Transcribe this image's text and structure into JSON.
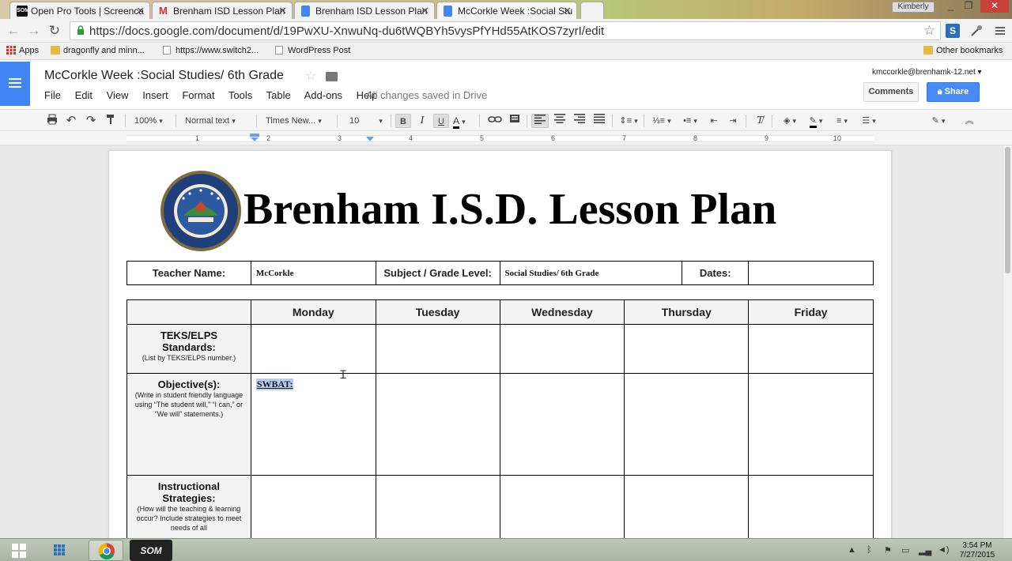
{
  "browser": {
    "tabs": [
      {
        "title": "Open Pro Tools | Screenca",
        "icon": "som-icon",
        "color": "#111111"
      },
      {
        "title": "Brenham ISD Lesson Plan",
        "icon": "gmail-icon",
        "color": "#d93025"
      },
      {
        "title": "Brenham ISD Lesson Plan",
        "icon": "docs-icon",
        "color": "#4285f4"
      },
      {
        "title": "McCorkle Week :Social Stu",
        "icon": "docs-icon",
        "color": "#4285f4"
      }
    ],
    "profile": "Kimberly",
    "url": "https://docs.google.com/document/d/19PwXU-XnwuNq-du6tWQBYh5vysPfYHd55AtKOS7zyrI/edit",
    "bookmarks": [
      "Apps",
      "dragonfly and minn...",
      "https://www.switch2...",
      "WordPress Post"
    ],
    "other_bookmarks": "Other bookmarks"
  },
  "docs": {
    "title": "McCorkle Week :Social Studies/ 6th Grade",
    "menu": [
      "File",
      "Edit",
      "View",
      "Insert",
      "Format",
      "Tools",
      "Table",
      "Add-ons",
      "Help"
    ],
    "saved_status": "All changes saved in Drive",
    "account": "kmccorkle@brenhamk-12.net",
    "comments_label": "Comments",
    "share_label": "Share",
    "toolbar": {
      "zoom": "100%",
      "style": "Normal text",
      "font": "Times New...",
      "size": "10",
      "bold": "B",
      "italic": "I",
      "underline": "U",
      "text_color": "A"
    },
    "ruler_numbers": [
      "1",
      "2",
      "3",
      "4",
      "5",
      "6",
      "7",
      "8",
      "9",
      "10"
    ]
  },
  "document": {
    "heading": "Brenham I.S.D. Lesson Plan",
    "info_row": {
      "teacher_label": "Teacher Name:",
      "teacher_value": "McCorkle",
      "subject_label": "Subject / Grade Level:",
      "subject_value": "Social Studies/ 6th Grade",
      "dates_label": "Dates:",
      "dates_value": ""
    },
    "days": [
      "Monday",
      "Tuesday",
      "Wednesday",
      "Thursday",
      "Friday"
    ],
    "rows": [
      {
        "label": "TEKS/ELPS Standards:",
        "sub": "(List by TEKS/ELPS number.)"
      },
      {
        "label": "Objective(s):",
        "sub": "(Write in student friendly language using “The student will,” “I can,” or “We will” statements.)"
      },
      {
        "label": "Instructional Strategies:",
        "sub": "(How will the teaching & learning occur?  Include strategies to meet needs of all"
      }
    ],
    "objective_monday": "SWBAT:"
  },
  "taskbar": {
    "time": "3:54 PM",
    "date": "7/27/2015"
  }
}
